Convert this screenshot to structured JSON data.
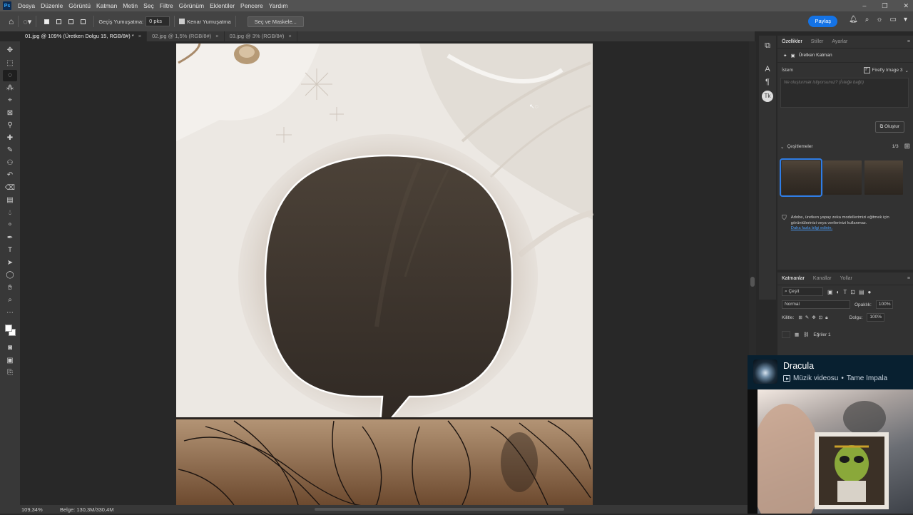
{
  "menubar": {
    "logo": "Ps",
    "items": [
      "Dosya",
      "Düzenle",
      "Görüntü",
      "Katman",
      "Metin",
      "Seç",
      "Filtre",
      "Görünüm",
      "Eklentiler",
      "Pencere",
      "Yardım"
    ]
  },
  "options": {
    "feather_label": "Geçiş Yumuşatma:",
    "feather_value": "0 pks",
    "antialias_label": "Kenar Yumuşatma",
    "select_mask": "Seç ve Maskele...",
    "share": "Paylaş"
  },
  "tabs": [
    {
      "label": "01.jpg @ 109% (Üretken Dolgu 15, RGB/8#) *"
    },
    {
      "label": "02.jpg @ 1,5% (RGB/8#)"
    },
    {
      "label": "03.jpg @ 3% (RGB/8#)"
    }
  ],
  "status": {
    "zoom": "109,34%",
    "doc": "Belge: 130,3M/330,4M"
  },
  "properties": {
    "tabs": [
      "Özellikler",
      "Stiller",
      "Ayarlar"
    ],
    "layer_type": "Üretken Katman",
    "prompt_label": "İstem",
    "model": "Firefly Image 3",
    "prompt_placeholder": "Ne oluşturmak istiyorsunuz? (İsteğe bağlı)",
    "generate": "Oluştur",
    "variations_label": "Çeşitlemeler",
    "variations_page": "1/3",
    "notice": "Adobe, üretken yapay zeka modellerimizi eğitmek için görüntülerinizi veya verilerinizi kullanmaz.",
    "notice_link": "Daha fazla bilgi edinin."
  },
  "layers": {
    "tabs": [
      "Katmanlar",
      "Kanallar",
      "Yollar"
    ],
    "filter": "Çeşit",
    "blend": "Normal",
    "opacity_label": "Opaklık:",
    "opacity_value": "100%",
    "lock_label": "Kilitle:",
    "fill_label": "Dolgu:",
    "fill_value": "100%",
    "layer1": "Eğriler 1"
  },
  "video": {
    "title": "Dracula",
    "type": "Müzik videosu",
    "artist": "Tame Impala"
  },
  "colors": {
    "accent": "#1473e6",
    "menubar": "#535353",
    "panel": "#323232",
    "bubble": "#3e352d"
  }
}
